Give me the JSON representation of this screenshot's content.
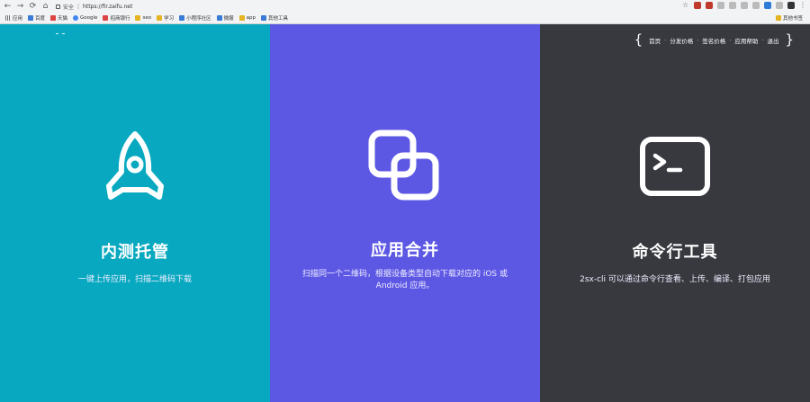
{
  "browser": {
    "secure_label": "安全",
    "url": "https://fir.zaifu.net",
    "bookmarks": [
      {
        "label": "应用"
      },
      {
        "label": "百度"
      },
      {
        "label": "天猫"
      },
      {
        "label": "Google"
      },
      {
        "label": "招商银行"
      },
      {
        "label": "seo"
      },
      {
        "label": "学习"
      },
      {
        "label": "小程序社区"
      },
      {
        "label": "微服"
      },
      {
        "label": "app"
      },
      {
        "label": "其他工具"
      }
    ],
    "other_bookmarks": "其他书签"
  },
  "topnav": {
    "items": [
      "首页",
      "分发价格",
      "签名价格",
      "应用帮助",
      "退出"
    ],
    "separator": "·"
  },
  "panels": [
    {
      "title": "内测托管",
      "desc": "一键上传应用，扫描二维码下载",
      "icon": "rocket-icon",
      "color": "#08a9c0"
    },
    {
      "title": "应用合并",
      "desc": "扫描同一个二维码，根据设备类型自动下载对应的 iOS 或 Android 应用。",
      "icon": "merge-squares-icon",
      "color": "#5d58e4"
    },
    {
      "title": "命令行工具",
      "desc": "2sx-cli 可以通过命令行查看、上传、编译、打包应用",
      "icon": "terminal-icon",
      "color": "#37393f"
    }
  ]
}
